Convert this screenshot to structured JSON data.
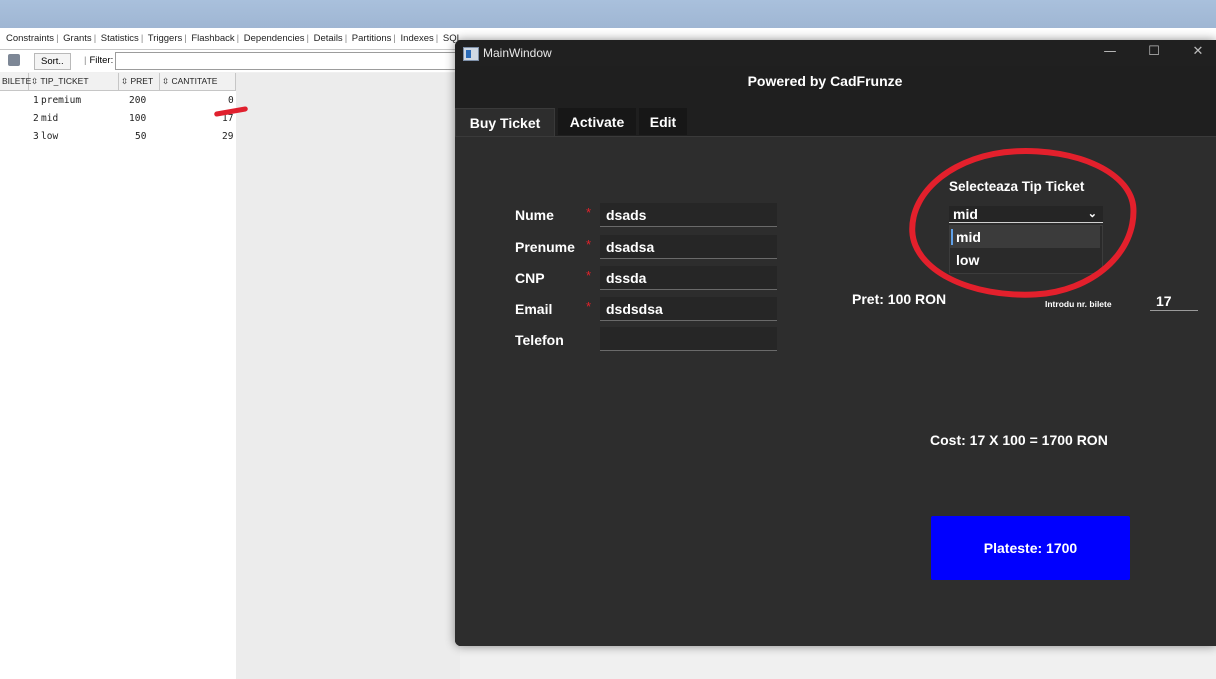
{
  "background_app": {
    "tabs": [
      "Constraints",
      "Grants",
      "Statistics",
      "Triggers",
      "Flashback",
      "Dependencies",
      "Details",
      "Partitions",
      "Indexes",
      "SQL"
    ],
    "toolbar": {
      "sort_label": "Sort..",
      "filter_label": "Filter:"
    },
    "grid": {
      "columns": [
        "BILETE",
        "TIP_TICKET",
        "PRET",
        "CANTITATE"
      ],
      "rows": [
        {
          "id": "1",
          "tip": "premium",
          "pret": "200",
          "cantitate": "0"
        },
        {
          "id": "2",
          "tip": "mid",
          "pret": "100",
          "cantitate": "17"
        },
        {
          "id": "3",
          "tip": "low",
          "pret": "50",
          "cantitate": "29"
        }
      ]
    }
  },
  "window": {
    "title": "MainWindow",
    "minimize": "—",
    "maximize": "☐",
    "close": "✕"
  },
  "header": {
    "powered_by": "Powered by CadFrunze"
  },
  "tabs": [
    {
      "label": "Buy Ticket",
      "active": true
    },
    {
      "label": "Activate",
      "active": false
    },
    {
      "label": "Edit",
      "active": false
    }
  ],
  "form": {
    "fields": [
      {
        "label": "Nume",
        "required": true,
        "value": "dsads"
      },
      {
        "label": "Prenume",
        "required": true,
        "value": "dsadsa"
      },
      {
        "label": "CNP",
        "required": true,
        "value": "dssda"
      },
      {
        "label": "Email",
        "required": true,
        "value": "dsdsdsa"
      },
      {
        "label": "Telefon",
        "required": false,
        "value": ""
      }
    ],
    "required_marker": "*"
  },
  "ticket_select": {
    "title": "Selecteaza Tip Ticket",
    "selected": "mid",
    "options": [
      "mid",
      "low"
    ],
    "highlighted_option": "mid"
  },
  "pricing": {
    "pret_text": "Pret: 100 RON",
    "qty_label": "Introdu nr. bilete",
    "qty_value": "17",
    "cost_text": "Cost: 17 X 100 = 1700 RON",
    "pay_button": "Plateste: 1700"
  },
  "colors": {
    "pay_button": "#0000ff",
    "annotation_red": "#e3202c",
    "dark_bg": "#2d2d2d"
  }
}
